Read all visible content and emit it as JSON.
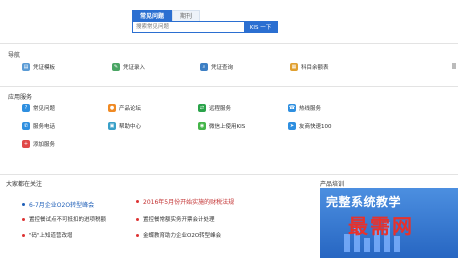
{
  "search": {
    "tabs": [
      {
        "label": "常见问题",
        "active": true
      },
      {
        "label": "期刊",
        "active": false
      }
    ],
    "placeholder": "搜索常见问题",
    "button_label": "KIS 一下"
  },
  "nav": {
    "title": "导航",
    "items": [
      {
        "label": "凭证模板",
        "icon": "voucher-template-icon"
      },
      {
        "label": "凭证录入",
        "icon": "voucher-entry-icon"
      },
      {
        "label": "凭证查询",
        "icon": "voucher-query-icon"
      },
      {
        "label": "科目余额表",
        "icon": "account-balance-icon"
      }
    ]
  },
  "app_services": {
    "title": "应用服务",
    "items": [
      {
        "label": "常见问题",
        "icon": "faq-icon",
        "color": "#2e8fe0"
      },
      {
        "label": "产品论坛",
        "icon": "forum-icon",
        "color": "#f08a24"
      },
      {
        "label": "远程服务",
        "icon": "remote-service-icon",
        "color": "#2aa34a"
      },
      {
        "label": "热线服务",
        "icon": "hotline-icon",
        "color": "#2e8fe0"
      },
      {
        "label": "服务电话",
        "icon": "phone-icon",
        "color": "#2e8fe0"
      },
      {
        "label": "帮助中心",
        "icon": "help-center-icon",
        "color": "#39a0c8"
      },
      {
        "label": "微信上使用KIS",
        "icon": "wechat-icon",
        "color": "#44b549"
      },
      {
        "label": "友商快速100",
        "icon": "express-icon",
        "color": "#2e8fe0"
      },
      {
        "label": "添加服务",
        "icon": "add-service-icon",
        "color": "#e04848"
      }
    ]
  },
  "news": {
    "title": "大家都在关注",
    "left": {
      "headline": "6-7月企业O2O转型峰会",
      "items": [
        "置控餐试点不可抵扣的进项税额",
        "\"码\"上知道营改增"
      ]
    },
    "right": {
      "headline": "2016年5月份开始实施的财税法规",
      "items": [
        "置控餐常额实务开票会计处理",
        "金蝶教育助力企业O2O转型峰会"
      ]
    }
  },
  "training": {
    "title": "产品培训",
    "banner_text": "完整系统教学",
    "watermark": "最需网"
  }
}
